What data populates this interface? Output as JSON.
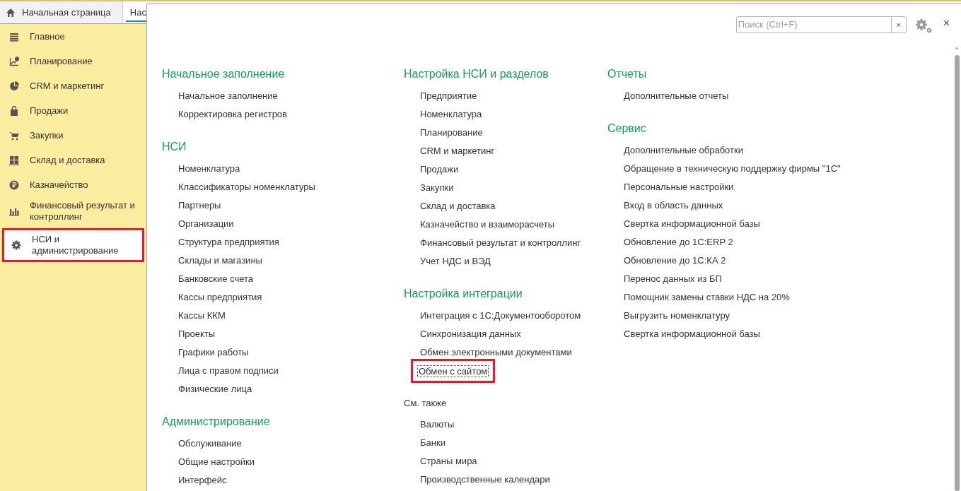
{
  "tabs": [
    {
      "label": "Начальная страница",
      "kind": "home",
      "selected": false
    },
    {
      "label": "Нас",
      "kind": "plain",
      "selected": true
    }
  ],
  "sidebar": {
    "items": [
      {
        "label": "Главное",
        "selected": false
      },
      {
        "label": "Планирование",
        "selected": false
      },
      {
        "label": "CRM и маркетинг",
        "selected": false
      },
      {
        "label": "Продажи",
        "selected": false
      },
      {
        "label": "Закупки",
        "selected": false
      },
      {
        "label": "Склад и доставка",
        "selected": false
      },
      {
        "label": "Казначейство",
        "selected": false
      },
      {
        "label": "Финансовый результат и контроллинг",
        "selected": false
      },
      {
        "label": "НСИ и администрирование",
        "selected": true
      }
    ]
  },
  "panel": {
    "search": {
      "placeholder": "Поиск (Ctrl+F)"
    },
    "clear_button": "×",
    "close_button": "×",
    "columns": [
      {
        "sections": [
          {
            "title": "Начальное заполнение",
            "kind": "heading",
            "links": [
              {
                "label": "Начальное заполнение",
                "focused": false
              },
              {
                "label": "Корректировка регистров",
                "focused": false
              }
            ]
          },
          {
            "title": "НСИ",
            "kind": "heading",
            "links": [
              {
                "label": "Номенклатура",
                "focused": false
              },
              {
                "label": "Классификаторы номенклатуры",
                "focused": false
              },
              {
                "label": "Партнеры",
                "focused": false
              },
              {
                "label": "Организации",
                "focused": false
              },
              {
                "label": "Структура предприятия",
                "focused": false
              },
              {
                "label": "Склады и магазины",
                "focused": false
              },
              {
                "label": "Банковские счета",
                "focused": false
              },
              {
                "label": "Кассы предприятия",
                "focused": false
              },
              {
                "label": "Кассы ККМ",
                "focused": false
              },
              {
                "label": "Проекты",
                "focused": false
              },
              {
                "label": "Графики работы",
                "focused": false
              },
              {
                "label": "Лица с правом подписи",
                "focused": false
              },
              {
                "label": "Физические лица",
                "focused": false
              }
            ]
          },
          {
            "title": "Администрирование",
            "kind": "heading",
            "links": [
              {
                "label": "Обслуживание",
                "focused": false
              },
              {
                "label": "Общие настройки",
                "focused": false
              },
              {
                "label": "Интерфейс",
                "focused": false
              }
            ]
          }
        ]
      },
      {
        "sections": [
          {
            "title": "Настройка НСИ и разделов",
            "kind": "heading",
            "links": [
              {
                "label": "Предприятие",
                "focused": false
              },
              {
                "label": "Номенклатура",
                "focused": false
              },
              {
                "label": "Планирование",
                "focused": false
              },
              {
                "label": "CRM и маркетинг",
                "focused": false
              },
              {
                "label": "Продажи",
                "focused": false
              },
              {
                "label": "Закупки",
                "focused": false
              },
              {
                "label": "Склад и доставка",
                "focused": false
              },
              {
                "label": "Казначейство и взаиморасчеты",
                "focused": false
              },
              {
                "label": "Финансовый результат и контроллинг",
                "focused": false
              },
              {
                "label": "Учет НДС и ВЭД",
                "focused": false
              }
            ]
          },
          {
            "title": "Настройка интеграции",
            "kind": "heading",
            "links": [
              {
                "label": "Интеграция с 1С:Документооборотом",
                "focused": false
              },
              {
                "label": "Синхронизация данных",
                "focused": false
              },
              {
                "label": "Обмен электронными документами",
                "focused": false
              },
              {
                "label": "Обмен с сайтом",
                "focused": true
              }
            ]
          },
          {
            "title": "См. также",
            "kind": "see_also",
            "links": [
              {
                "label": "Валюты",
                "focused": false
              },
              {
                "label": "Банки",
                "focused": false
              },
              {
                "label": "Страны мира",
                "focused": false
              },
              {
                "label": "Производственные календари",
                "focused": false
              }
            ]
          }
        ]
      },
      {
        "sections": [
          {
            "title": "Отчеты",
            "kind": "heading",
            "links": [
              {
                "label": "Дополнительные отчеты",
                "focused": false
              }
            ]
          },
          {
            "title": "Сервис",
            "kind": "heading",
            "links": [
              {
                "label": "Дополнительные обработки",
                "focused": false
              },
              {
                "label": "Обращение в техническую поддержку фирмы \"1С\"",
                "focused": false
              },
              {
                "label": "Персональные настройки",
                "focused": false
              },
              {
                "label": "Вход в область данных",
                "focused": false
              },
              {
                "label": "Свертка информационной базы",
                "focused": false
              },
              {
                "label": "Обновление до 1С:ERP 2",
                "focused": false
              },
              {
                "label": "Обновление до 1С:КА 2",
                "focused": false
              },
              {
                "label": "Перенос данных из БП",
                "focused": false
              },
              {
                "label": "Помощник замены ставки НДС на 20%",
                "focused": false
              },
              {
                "label": "Выгрузить номенклатуру",
                "focused": false
              },
              {
                "label": "Свертка информационной базы",
                "focused": false
              }
            ]
          }
        ]
      }
    ]
  }
}
